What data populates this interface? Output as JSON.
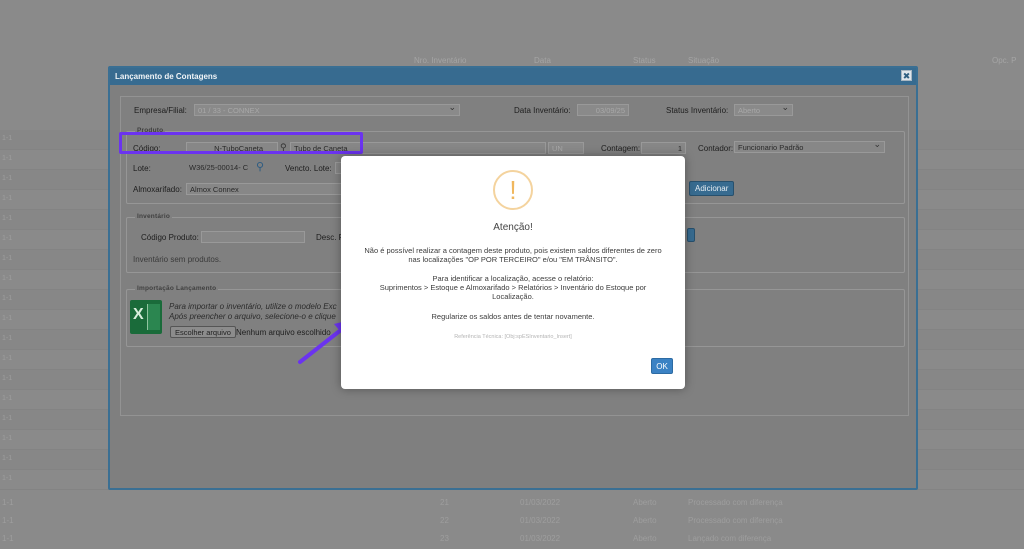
{
  "background": {
    "headers": [
      "Nro. Inventário",
      "Data",
      "Status",
      "Situação",
      "Opc. P"
    ],
    "row_labels": [
      "1-1",
      "1-1",
      "1-1",
      "1-1",
      "1-1",
      "1-1",
      "1-1",
      "1-1",
      "1-1",
      "1-1",
      "1-1",
      "1-1",
      "1-1",
      "1-1",
      "1-1",
      "1-1",
      "1-1",
      "1-1"
    ],
    "bottom_rows": [
      {
        "c1": "1-1",
        "num": "21",
        "date": "01/03/2022",
        "status": "Aberto",
        "sit": "Processado com diferença"
      },
      {
        "c1": "1-1",
        "num": "22",
        "date": "01/03/2022",
        "status": "Aberto",
        "sit": "Processado com diferença"
      },
      {
        "c1": "1-1",
        "num": "23",
        "date": "01/03/2022",
        "status": "Aberto",
        "sit": "Lançado com diferença"
      }
    ]
  },
  "modal": {
    "title": "Lançamento de Contagens",
    "close_glyph": "✖",
    "empresa_label": "Empresa/Filial:",
    "empresa_value": "01 / 33 - CONNEX",
    "data_inv_label": "Data Inventário:",
    "data_inv_value": "03/09/25",
    "status_inv_label": "Status Inventário:",
    "status_inv_value": "Aberto",
    "produto_legend": "Produto",
    "codigo_label": "Código:",
    "codigo_value": "N-TuboCaneta",
    "descricao_value": "Tubo de Caneta",
    "un_value": "UN",
    "contagem_label": "Contagem:",
    "contagem_value": "1",
    "contador_label": "Contador:",
    "contador_value": "Funcionario Padrão",
    "lote_label": "Lote:",
    "lote_value": "W36/25-00014- C",
    "vencto_label": "Vencto. Lote:",
    "almox_label": "Almoxarifado:",
    "almox_value": "Almox Connex",
    "adicionar_label": "Adicionar",
    "inventario_legend": "Inventário",
    "codigo_produto_label": "Código Produto:",
    "desc_label": "Desc. P",
    "inventario_empty": "Inventário sem produtos.",
    "importacao_legend": "Importação Lançamento",
    "import_text_1": "Para importar o inventário, utilize o modelo Exc",
    "import_text_2": "Após preencher o arquivo, selecione-o e clique",
    "choose_file_label": "Escolher arquivo",
    "no_file_label": "Nenhum arquivo escolhido"
  },
  "alert": {
    "icon_glyph": "!",
    "title": "Atenção!",
    "line1": "Não é possível realizar a contagem deste produto, pois existem saldos diferentes de zero",
    "line2": "nas localizações \"OP POR TERCEIRO\" e/ou \"EM TRÂNSITO\".",
    "line3": "Para identificar a localização, acesse o relatório:",
    "line4": "Suprimentos > Estoque e Almoxarifado > Relatórios > Inventário do Estoque por",
    "line5": "Localização.",
    "line6": "Regularize os saldos antes de tentar novamente.",
    "reference": "Referência Técnica: [Obj:spESInventario_Insert]",
    "ok_label": "OK"
  },
  "colors": {
    "highlight": "#6b33f0",
    "arrow": "#6b33f0",
    "titlebar": "#376b90",
    "ok_button": "#3b82c4",
    "warning_icon": "#f0b75e"
  }
}
